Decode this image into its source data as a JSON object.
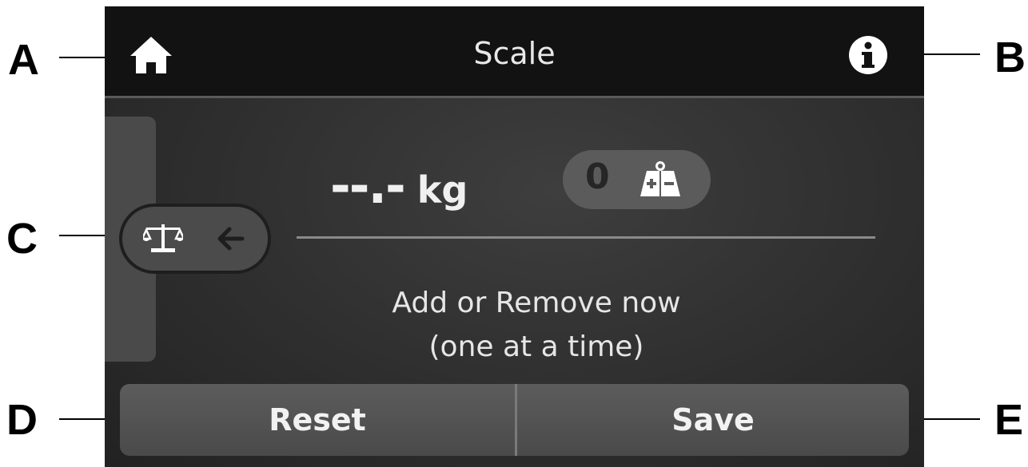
{
  "callouts": {
    "a": "A",
    "b": "B",
    "c": "C",
    "d": "D",
    "e": "E"
  },
  "header": {
    "title": "Scale",
    "home_icon": "home-icon",
    "info_icon": "info-icon"
  },
  "side_tab": {
    "icons": [
      "scale-icon",
      "arrow-left-icon"
    ]
  },
  "reading": {
    "value": "--.-",
    "unit": "kg"
  },
  "counter": {
    "value": "0",
    "icon": "weight-add-remove-icon"
  },
  "instructions": {
    "line1": "Add or Remove now",
    "line2": "(one at a time)"
  },
  "buttons": {
    "reset_label": "Reset",
    "save_label": "Save"
  },
  "colors": {
    "topbar": "#121212",
    "background": "#2e2e2e",
    "button": "#555555",
    "text": "#f0f0f0"
  }
}
